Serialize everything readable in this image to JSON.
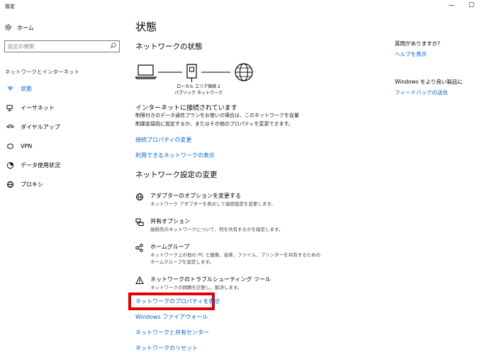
{
  "window": {
    "title": "設定",
    "minimize_glyph": "—",
    "maximize_glyph": "☐"
  },
  "sidebar": {
    "home_label": "ホーム",
    "search_placeholder": "設定の検索",
    "section_title": "ネットワークとインターネット",
    "items": [
      {
        "label": "状態",
        "icon": "status-icon"
      },
      {
        "label": "イーサネット",
        "icon": "ethernet-icon"
      },
      {
        "label": "ダイヤルアップ",
        "icon": "dialup-icon"
      },
      {
        "label": "VPN",
        "icon": "vpn-icon"
      },
      {
        "label": "データ使用状況",
        "icon": "data-usage-icon"
      },
      {
        "label": "プロキシ",
        "icon": "proxy-icon"
      }
    ]
  },
  "main": {
    "page_title": "状態",
    "network_status_heading": "ネットワークの状態",
    "connection_label_line1": "ローカル エリア接続 2",
    "connection_label_line2": "パブリック ネットワーク",
    "connected_heading": "インターネットに接続されています",
    "connected_desc_line1": "制限付きのデータ通信プランをお使いの場合は、このネットワークを従量",
    "connected_desc_line2": "制課金接続に設定するか、またはその他のプロパティを変更できます。",
    "link_change_properties": "接続プロパティの変更",
    "link_show_networks": "利用できるネットワークの表示",
    "change_settings_heading": "ネットワーク設定の変更",
    "options": [
      {
        "title": "アダプターのオプションを変更する",
        "desc": [
          "ネットワーク アダプターを表示して接続設定を変更します。"
        ],
        "icon": "adapter-icon"
      },
      {
        "title": "共有オプション",
        "desc": [
          "接続先のネットワークについて、何を共有するかを指定します。"
        ],
        "icon": "sharing-icon"
      },
      {
        "title": "ホームグループ",
        "desc": [
          "ネットワーク上の他の PC と画像、音楽、ファイル、プリンターを共有するための",
          "ホームグループを設定します。"
        ],
        "icon": "homegroup-icon"
      },
      {
        "title": "ネットワークのトラブルシューティング ツール",
        "desc": [
          "ネットワークの問題を診断し、解決します。"
        ],
        "icon": "warning-icon"
      }
    ],
    "link_view_properties": "ネットワークのプロパティを表示",
    "link_firewall": "Windows ファイアウォール",
    "link_sharing_center": "ネットワークと共有センター",
    "link_reset": "ネットワークのリセット"
  },
  "side_panel": {
    "question_heading": "質問がありますか?",
    "help_link": "ヘルプを表示",
    "improve_heading": "Windows をより良い製品に",
    "feedback_link": "フィードバックの送信"
  },
  "colors": {
    "accent": "#0066cc",
    "highlight_border": "#e60000"
  }
}
